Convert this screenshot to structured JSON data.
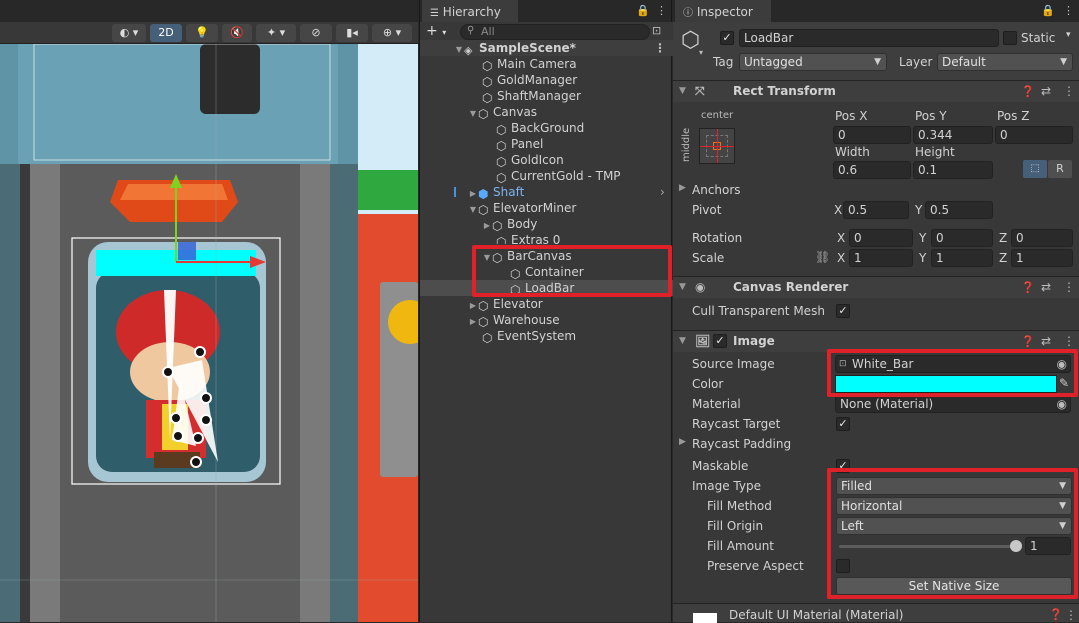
{
  "scene": {
    "toolbar": {
      "mode_2d": "2D"
    }
  },
  "hierarchy": {
    "tab": "Hierarchy",
    "search_placeholder": "All",
    "lock_icon": "lock-icon",
    "items": [
      {
        "label": "SampleScene*"
      },
      {
        "label": "Main Camera"
      },
      {
        "label": "GoldManager"
      },
      {
        "label": "ShaftManager"
      },
      {
        "label": "Canvas"
      },
      {
        "label": "BackGround"
      },
      {
        "label": "Panel"
      },
      {
        "label": "GoldIcon"
      },
      {
        "label": "CurrentGold - TMP"
      },
      {
        "label": "Shaft"
      },
      {
        "label": "ElevatorMiner"
      },
      {
        "label": "Body"
      },
      {
        "label": "Extras 0"
      },
      {
        "label": "BarCanvas"
      },
      {
        "label": "Container"
      },
      {
        "label": "LoadBar"
      },
      {
        "label": "Elevator"
      },
      {
        "label": "Warehouse"
      },
      {
        "label": "EventSystem"
      }
    ]
  },
  "inspector": {
    "tab": "Inspector",
    "object_name": "LoadBar",
    "static_label": "Static",
    "tag_label": "Tag",
    "tag_value": "Untagged",
    "layer_label": "Layer",
    "layer_value": "Default",
    "rect_transform": {
      "title": "Rect Transform",
      "anchor_h": "center",
      "anchor_v": "middle",
      "posx_label": "Pos X",
      "posx": "0",
      "posy_label": "Pos Y",
      "posy": "0.344",
      "posz_label": "Pos Z",
      "posz": "0",
      "width_label": "Width",
      "width": "0.6",
      "height_label": "Height",
      "height": "0.1",
      "r_btn": "R",
      "anchors_label": "Anchors",
      "pivot_label": "Pivot",
      "pivot_x": "0.5",
      "pivot_y": "0.5",
      "rotation_label": "Rotation",
      "rot_x": "0",
      "rot_y": "0",
      "rot_z": "0",
      "scale_label": "Scale",
      "scale_x": "1",
      "scale_y": "1",
      "scale_z": "1",
      "x": "X",
      "y": "Y",
      "z": "Z"
    },
    "canvas_renderer": {
      "title": "Canvas Renderer",
      "cull_label": "Cull Transparent Mesh"
    },
    "image": {
      "title": "Image",
      "source_label": "Source Image",
      "source_value": "White_Bar",
      "color_label": "Color",
      "color_value": "#00ffff",
      "material_label": "Material",
      "material_value": "None (Material)",
      "raycast_target_label": "Raycast Target",
      "raycast_padding_label": "Raycast Padding",
      "maskable_label": "Maskable",
      "image_type_label": "Image Type",
      "image_type_value": "Filled",
      "fill_method_label": "Fill Method",
      "fill_method_value": "Horizontal",
      "fill_origin_label": "Fill Origin",
      "fill_origin_value": "Left",
      "fill_amount_label": "Fill Amount",
      "fill_amount_value": "1",
      "preserve_label": "Preserve Aspect",
      "native_size_btn": "Set Native Size"
    },
    "footer_material": "Default UI Material (Material)"
  },
  "colors": {
    "accent": "#00ffff",
    "highlight": "#e0212a",
    "selection": "#4d4d4d"
  }
}
